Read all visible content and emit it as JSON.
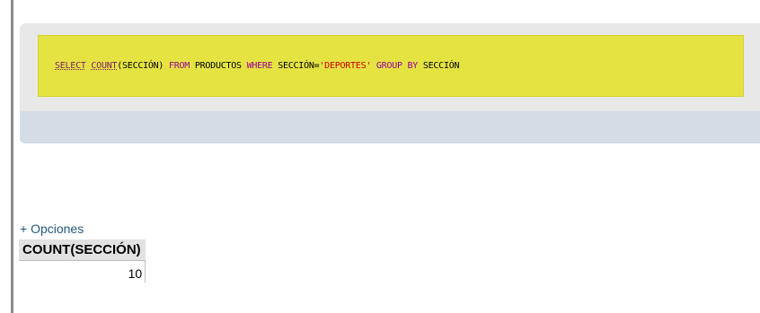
{
  "query": {
    "select": "SELECT",
    "count_fn": "COUNT",
    "count_arg": "(SECCIÓN)",
    "from": "FROM",
    "table": "PRODUCTOS",
    "where": "WHERE",
    "column": "SECCIÓN",
    "equals": "=",
    "value": "'DEPORTES'",
    "group_by": "GROUP BY",
    "group_col": "SECCIÓN"
  },
  "options_link": "+ Opciones",
  "result": {
    "columns": [
      "COUNT(SECCIÓN)"
    ],
    "rows": [
      [
        "10"
      ]
    ]
  },
  "colors": {
    "sql_highlight": "#e5e342",
    "panel_bg": "#e8e8e8",
    "panel_footer": "#d4dce6",
    "keyword": "#990099",
    "string": "#cc0000",
    "link": "#235a81"
  }
}
